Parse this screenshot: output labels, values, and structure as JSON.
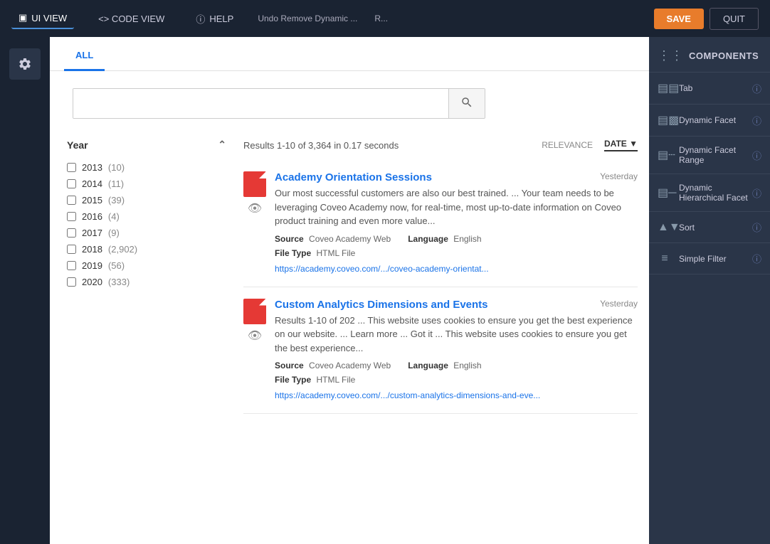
{
  "topbar": {
    "ui_view_label": "UI VIEW",
    "code_view_label": "<> CODE VIEW",
    "help_label": "HELP",
    "undo_label": "Undo Remove Dynamic ...",
    "redo_label": "R...",
    "save_label": "SAVE",
    "quit_label": "QUIT"
  },
  "tabs": [
    {
      "label": "ALL",
      "active": true
    }
  ],
  "search": {
    "placeholder": "",
    "value": ""
  },
  "facets": {
    "year": {
      "label": "Year",
      "items": [
        {
          "year": "2013",
          "count": "(10)"
        },
        {
          "year": "2014",
          "count": "(11)"
        },
        {
          "year": "2015",
          "count": "(39)"
        },
        {
          "year": "2016",
          "count": "(4)"
        },
        {
          "year": "2017",
          "count": "(9)"
        },
        {
          "year": "2018",
          "count": "(2,902)"
        },
        {
          "year": "2019",
          "count": "(56)"
        },
        {
          "year": "2020",
          "count": "(333)"
        }
      ]
    }
  },
  "results": {
    "summary": "Results 1-10 of 3,364 in 0.17 seconds",
    "sort_options": [
      {
        "label": "RELEVANCE",
        "active": false
      },
      {
        "label": "DATE",
        "active": true
      }
    ],
    "items": [
      {
        "title": "Academy Orientation Sessions",
        "date": "Yesterday",
        "excerpt": "Our most successful customers are also our best trained. ... Your team needs to be leveraging Coveo Academy now, for real-time, most up-to-date information on Coveo product training and even more value...",
        "source_label": "Source",
        "source_value": "Coveo Academy Web",
        "language_label": "Language",
        "language_value": "English",
        "filetype_label": "File Type",
        "filetype_value": "HTML File",
        "url": "https://academy.coveo.com/.../coveo-academy-orientat...",
        "file_ext": "</>"
      },
      {
        "title": "Custom Analytics Dimensions and Events",
        "date": "Yesterday",
        "excerpt": "Results 1-10 of 202 ... This website uses cookies to ensure you get the best experience on our website. ... Learn more ... Got it ... This website uses cookies to ensure you get the best experience...",
        "source_label": "Source",
        "source_value": "Coveo Academy Web",
        "language_label": "Language",
        "language_value": "English",
        "filetype_label": "File Type",
        "filetype_value": "HTML File",
        "url": "https://academy.coveo.com/.../custom-analytics-dimensions-and-eve...",
        "file_ext": "</>"
      }
    ]
  },
  "components_panel": {
    "title": "COMPONENTS",
    "items": [
      {
        "label": "Tab",
        "icon": "tab"
      },
      {
        "label": "Dynamic Facet",
        "icon": "facet"
      },
      {
        "label": "Dynamic Facet Range",
        "icon": "facet-range"
      },
      {
        "label": "Dynamic Hierarchical Facet",
        "icon": "facet-hier"
      },
      {
        "label": "Sort",
        "icon": "sort"
      },
      {
        "label": "Simple Filter",
        "icon": "filter"
      }
    ]
  }
}
